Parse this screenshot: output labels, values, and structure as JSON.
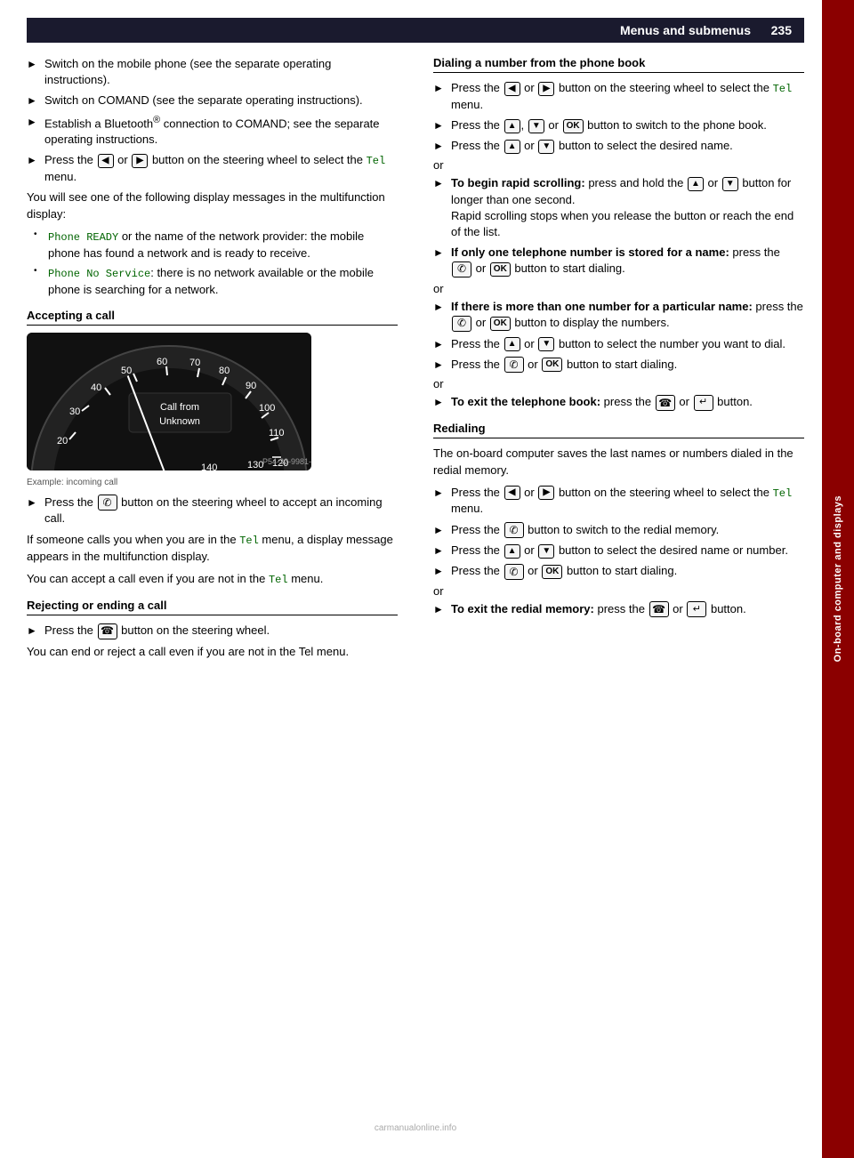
{
  "header": {
    "title": "Menus and submenus",
    "page_number": "235"
  },
  "sidebar": {
    "label": "On-board computer and displays"
  },
  "left_column": {
    "intro_bullets": [
      "Switch on the mobile phone (see the separate operating instructions).",
      "Switch on COMAND (see the separate operating instructions).",
      "Establish a Bluetooth® connection to COMAND; see the separate operating instructions.",
      "Press the [◄] or [►] button on the steering wheel to select the Tel menu."
    ],
    "display_text": "You will see one of the following display messages in the multifunction display:",
    "display_items": [
      {
        "code": "Phone READY",
        "text": " or the name of the network provider: the mobile phone has found a network and is ready to receive."
      },
      {
        "code": "Phone No Service",
        "text": ": there is no network available or the mobile phone is searching for a network."
      }
    ],
    "accepting_call": {
      "heading": "Accepting a call",
      "caption": "Example: incoming call",
      "gauge_labels": [
        "60",
        "70",
        "80",
        "90",
        "100",
        "50",
        "110",
        "40",
        "120",
        "30",
        "130",
        "20",
        "140"
      ],
      "call_text_line1": "Call from",
      "call_text_line2": "Unknown",
      "bullet": "Press the [☎] button on the steering wheel to accept an incoming call.",
      "para1": "If someone calls you when you are in the Tel menu, a display message appears in the multifunction display.",
      "para2": "You can accept a call even if you are not in the Tel menu."
    },
    "rejecting_call": {
      "heading": "Rejecting or ending a call",
      "bullet": "Press the [🔴] button on the steering wheel.",
      "para": "You can end or reject a call even if you are not in the Tel menu."
    }
  },
  "right_column": {
    "dialing_heading": "Dialing a number from the phone book",
    "dialing_bullets": [
      {
        "type": "button",
        "text": "Press the [◄] or [►] button on the steering wheel to select the Tel menu."
      },
      {
        "type": "button",
        "text": "Press the [▲], [▼] or [OK] button to switch to the phone book."
      },
      {
        "type": "button",
        "text": "Press the [▲] or [▼] button to select the desired name."
      }
    ],
    "or1": "or",
    "rapid_scroll": {
      "bold_start": "To begin rapid scrolling:",
      "text": " press and hold the [▲] or [▼] button for longer than one second.",
      "sub_text": "Rapid scrolling stops when you release the button or reach the end of the list."
    },
    "or2": "or",
    "only_one_number": {
      "bold_start": "If only one telephone number is stored for a name:",
      "text": " press the [☎] or [OK] button to start dialing."
    },
    "or3": "or",
    "more_than_one": {
      "bold_start": "If there is more than one number for a particular name:",
      "text": " press the [☎] or [OK] button to display the numbers."
    },
    "after_more": [
      "Press the [▲] or [▼] button to select the number you want to dial.",
      "Press the [☎] or [OK] button to start dialing."
    ],
    "or4": "or",
    "exit_phone_book": {
      "bold_start": "To exit the telephone book:",
      "text": " press the [🔴] or [↩] button."
    },
    "redialing_heading": "Redialing",
    "redialing_intro": "The on-board computer saves the last names or numbers dialed in the redial memory.",
    "redialing_bullets": [
      "Press the [◄] or [►] button on the steering wheel to select the Tel menu.",
      "Press the [☎] button to switch to the redial memory.",
      "Press the [▲] or [▼] button to select the desired name or number.",
      "Press the [☎] or [OK] button to start dialing."
    ],
    "or5": "or",
    "exit_redial": {
      "bold_start": "To exit the redial memory:",
      "text": " press the [🔴] or [↩] button."
    }
  },
  "buttons": {
    "left_arrow": "◄",
    "right_arrow": "►",
    "up_arrow": "▲",
    "down_arrow": "▼",
    "ok": "OK",
    "call": "☎",
    "end_call": "⬛",
    "back": "↩"
  },
  "website": "carmanualonline.info"
}
